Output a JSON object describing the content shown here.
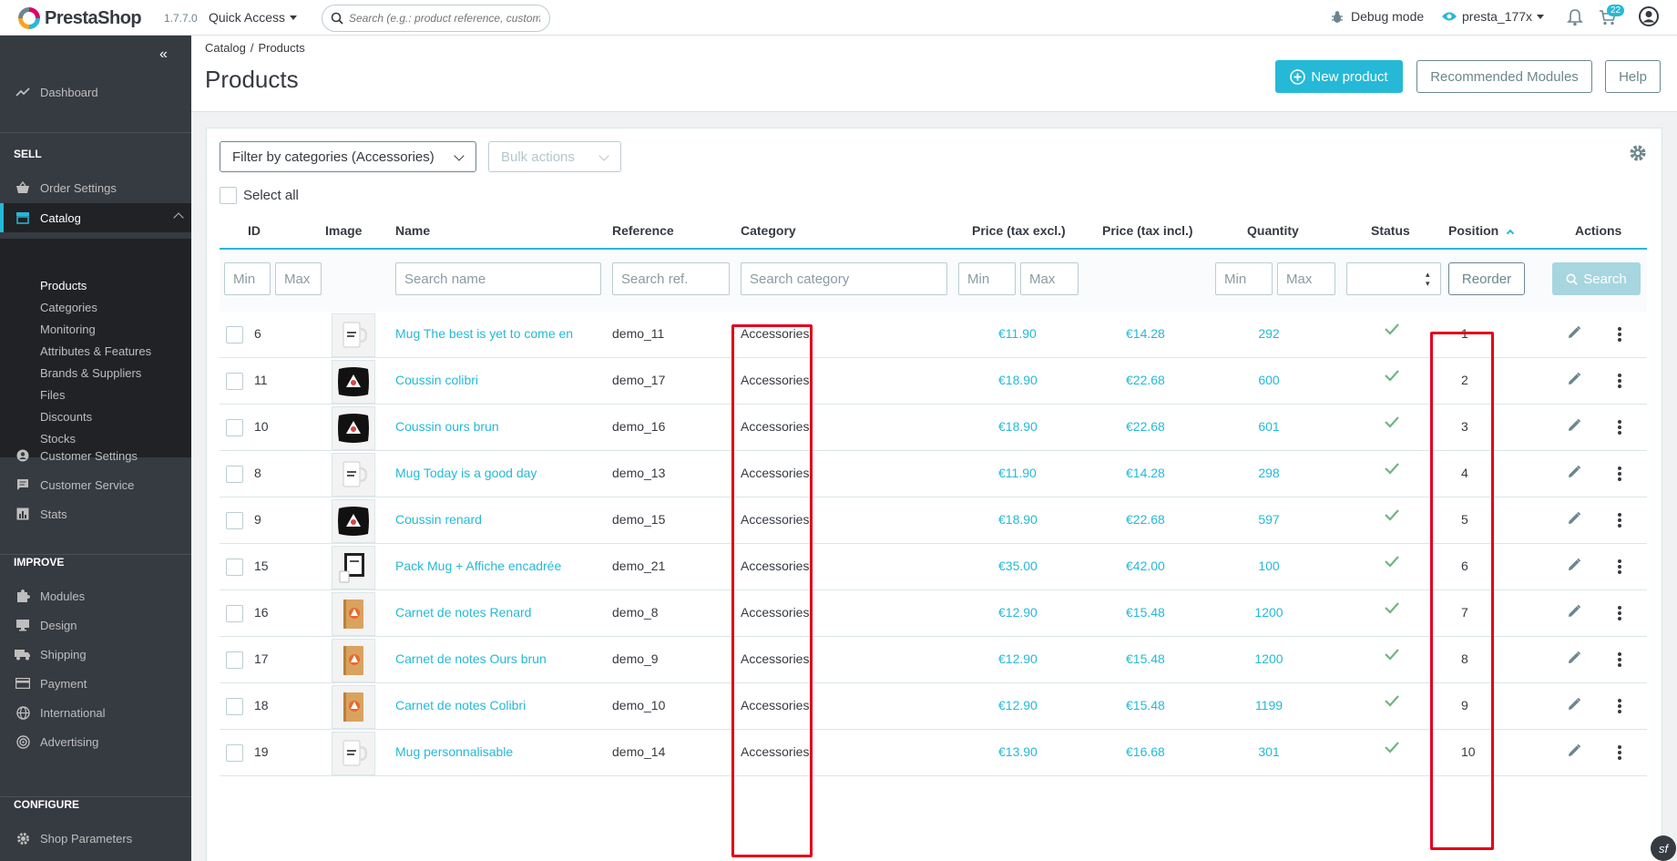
{
  "header": {
    "logo_text": "PrestaShop",
    "version": "1.7.7.0",
    "quick_access_label": "Quick Access",
    "search_placeholder": "Search (e.g.: product reference, custome",
    "debug_label": "Debug mode",
    "user_label": "presta_177x",
    "cart_badge": "22"
  },
  "sidebar": {
    "dashboard": "Dashboard",
    "sections": {
      "sell": "SELL",
      "improve": "IMPROVE",
      "configure": "CONFIGURE"
    },
    "sell_items": [
      {
        "label": "Order Settings",
        "icon": "basket-icon"
      },
      {
        "label": "Catalog",
        "icon": "store-icon"
      },
      {
        "label": "Customer Settings",
        "icon": "account-icon"
      },
      {
        "label": "Customer Service",
        "icon": "chat-icon"
      },
      {
        "label": "Stats",
        "icon": "stats-icon"
      }
    ],
    "catalog_submenu": [
      "Products",
      "Categories",
      "Monitoring",
      "Attributes & Features",
      "Brands & Suppliers",
      "Files",
      "Discounts",
      "Stocks"
    ],
    "improve_items": [
      {
        "label": "Modules",
        "icon": "puzzle-icon"
      },
      {
        "label": "Design",
        "icon": "desktop-icon"
      },
      {
        "label": "Shipping",
        "icon": "truck-icon"
      },
      {
        "label": "Payment",
        "icon": "card-icon"
      },
      {
        "label": "International",
        "icon": "globe-icon"
      },
      {
        "label": "Advertising",
        "icon": "target-icon"
      }
    ],
    "configure_items": [
      {
        "label": "Shop Parameters",
        "icon": "settings-icon"
      }
    ]
  },
  "page": {
    "breadcrumb": [
      "Catalog",
      "Products"
    ],
    "title": "Products",
    "new_product_label": "New product",
    "recommended_modules_label": "Recommended Modules",
    "help_label": "Help"
  },
  "toolbar": {
    "filter_categories_label": "Filter by categories (Accessories)",
    "bulk_actions_label": "Bulk actions",
    "select_all_label": "Select all"
  },
  "table": {
    "columns": [
      "ID",
      "Image",
      "Name",
      "Reference",
      "Category",
      "Price (tax excl.)",
      "Price (tax incl.)",
      "Quantity",
      "Status",
      "Position",
      "Actions"
    ],
    "filters": {
      "id_min": "Min",
      "id_max": "Max",
      "name": "Search name",
      "reference": "Search ref.",
      "category": "Search category",
      "price_min": "Min",
      "price_max": "Max",
      "qty_min": "Min",
      "qty_max": "Max",
      "reorder_label": "Reorder",
      "search_label": "Search"
    },
    "rows": [
      {
        "id": "6",
        "name": "Mug The best is yet to come en",
        "reference": "demo_11",
        "category": "Accessories",
        "price_excl": "€11.90",
        "price_incl": "€14.28",
        "quantity": "292",
        "position": "1",
        "thumb": "mug"
      },
      {
        "id": "11",
        "name": "Coussin colibri",
        "reference": "demo_17",
        "category": "Accessories",
        "price_excl": "€18.90",
        "price_incl": "€22.68",
        "quantity": "600",
        "position": "2",
        "thumb": "cushion"
      },
      {
        "id": "10",
        "name": "Coussin ours brun",
        "reference": "demo_16",
        "category": "Accessories",
        "price_excl": "€18.90",
        "price_incl": "€22.68",
        "quantity": "601",
        "position": "3",
        "thumb": "cushion"
      },
      {
        "id": "8",
        "name": "Mug Today is a good day",
        "reference": "demo_13",
        "category": "Accessories",
        "price_excl": "€11.90",
        "price_incl": "€14.28",
        "quantity": "298",
        "position": "4",
        "thumb": "mug"
      },
      {
        "id": "9",
        "name": "Coussin renard",
        "reference": "demo_15",
        "category": "Accessories",
        "price_excl": "€18.90",
        "price_incl": "€22.68",
        "quantity": "597",
        "position": "5",
        "thumb": "cushion"
      },
      {
        "id": "15",
        "name": "Pack Mug + Affiche encadrée",
        "reference": "demo_21",
        "category": "Accessories",
        "price_excl": "€35.00",
        "price_incl": "€42.00",
        "quantity": "100",
        "position": "6",
        "thumb": "pack"
      },
      {
        "id": "16",
        "name": "Carnet de notes Renard",
        "reference": "demo_8",
        "category": "Accessories",
        "price_excl": "€12.90",
        "price_incl": "€15.48",
        "quantity": "1200",
        "position": "7",
        "thumb": "notebook"
      },
      {
        "id": "17",
        "name": "Carnet de notes Ours brun",
        "reference": "demo_9",
        "category": "Accessories",
        "price_excl": "€12.90",
        "price_incl": "€15.48",
        "quantity": "1200",
        "position": "8",
        "thumb": "notebook"
      },
      {
        "id": "18",
        "name": "Carnet de notes Colibri",
        "reference": "demo_10",
        "category": "Accessories",
        "price_excl": "€12.90",
        "price_incl": "€15.48",
        "quantity": "1199",
        "position": "9",
        "thumb": "notebook"
      },
      {
        "id": "19",
        "name": "Mug personnalisable",
        "reference": "demo_14",
        "category": "Accessories",
        "price_excl": "€13.90",
        "price_incl": "€16.68",
        "quantity": "301",
        "position": "10",
        "thumb": "mug"
      }
    ]
  },
  "colors": {
    "accent": "#25b9d7",
    "sidebar_bg": "#363a41",
    "highlight": "#e2001a",
    "status_ok": "#70b580"
  }
}
